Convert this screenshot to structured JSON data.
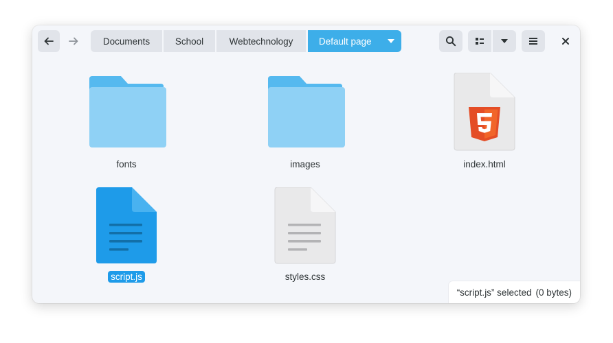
{
  "breadcrumb": {
    "items": [
      "Documents",
      "School",
      "Webtechnology"
    ],
    "current": "Default page"
  },
  "toolbar": {
    "back_icon": "arrow-left-icon",
    "forward_icon": "arrow-right-icon",
    "search_icon": "search-icon",
    "view_icon": "list-view-icon",
    "view_options_icon": "chevron-down-icon",
    "menu_icon": "hamburger-menu-icon",
    "close_icon": "close-icon"
  },
  "files": [
    {
      "name": "fonts",
      "type": "folder",
      "selected": false
    },
    {
      "name": "images",
      "type": "folder",
      "selected": false
    },
    {
      "name": "index.html",
      "type": "html",
      "selected": false
    },
    {
      "name": "script.js",
      "type": "text",
      "selected": true
    },
    {
      "name": "styles.css",
      "type": "text",
      "selected": false
    }
  ],
  "status": {
    "selected": "“script.js” selected",
    "size": "(0 bytes)"
  },
  "colors": {
    "accent": "#3daee9",
    "selection": "#1e9be9",
    "folder": "#8fd1f5",
    "folder_tab": "#55b9ef",
    "html_badge": "#e44d26"
  }
}
